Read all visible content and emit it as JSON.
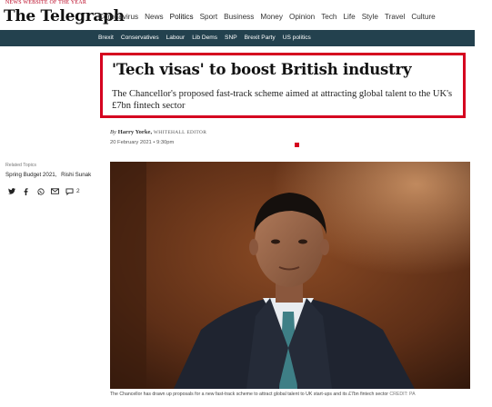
{
  "header": {
    "award": "NEWS WEBSITE OF THE YEAR",
    "logo": "The Telegraph",
    "nav": [
      "Coronavirus",
      "News",
      "Politics",
      "Sport",
      "Business",
      "Money",
      "Opinion",
      "Tech",
      "Life",
      "Style",
      "Travel",
      "Culture"
    ],
    "active_nav": "Politics"
  },
  "subnav": [
    "Brexit",
    "Conservatives",
    "Labour",
    "Lib Dems",
    "SNP",
    "Brexit Party",
    "US politics"
  ],
  "article": {
    "headline": "'Tech visas' to boost British industry",
    "standfirst": "The Chancellor's proposed fast-track scheme aimed at attracting global talent to the UK's £7bn fintech sector",
    "byline_prefix": "By",
    "author": "Harry Yorke,",
    "author_role": "WHITEHALL EDITOR",
    "date": "20 February 2021 • 9:30pm"
  },
  "related": {
    "label": "Related Topics",
    "topics": [
      "Spring Budget 2021,",
      "Rishi Sunak"
    ]
  },
  "share": {
    "icons": [
      "twitter-icon",
      "facebook-icon",
      "whatsapp-icon",
      "email-icon",
      "comment-icon"
    ],
    "comment_count": "2"
  },
  "photo": {
    "caption": "The Chancellor has drawn up proposals for a new fast-track scheme to attract global talent to UK start-ups and its £7bn fintech sector",
    "credit": "CREDIT: PA"
  },
  "colors": {
    "subnav_bg": "#23414e",
    "highlight_border": "#d5001f",
    "award_red": "#b8001f"
  }
}
